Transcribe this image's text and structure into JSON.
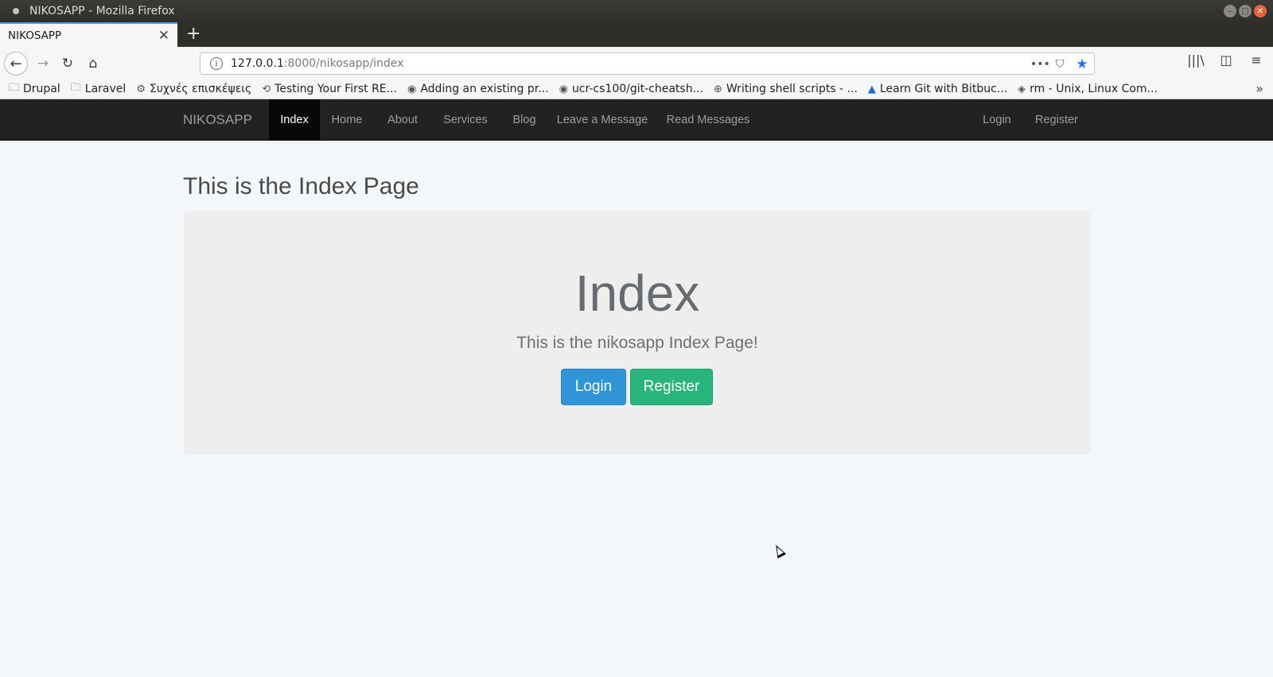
{
  "window": {
    "title": "NIKOSAPP - Mozilla Firefox"
  },
  "tab": {
    "label": "NIKOSAPP",
    "close_icon": "✕",
    "new_tab_icon": "+"
  },
  "urlbar": {
    "host": "127.0.0.1",
    "rest": ":8000/nikosapp/index",
    "more_icon": "•••",
    "pocket_icon": "⛉",
    "star_icon": "★"
  },
  "toolbar_icons": {
    "back": "←",
    "forward": "→",
    "reload": "↻",
    "home": "⌂",
    "library": "|||\\",
    "sidebar": "◫",
    "menu": "≡"
  },
  "bookmarks": [
    {
      "label": "Drupal",
      "icon": "folder-icon",
      "glyph": "🗀"
    },
    {
      "label": "Laravel",
      "icon": "folder-icon",
      "glyph": "🗀"
    },
    {
      "label": "Συχνές επισκέψεις",
      "icon": "gear-icon",
      "glyph": "⚙"
    },
    {
      "label": "Testing Your First RE...",
      "icon": "link-icon",
      "glyph": "⟲"
    },
    {
      "label": "Adding an existing pr...",
      "icon": "github-icon",
      "glyph": "◉"
    },
    {
      "label": "ucr-cs100/git-cheatsh...",
      "icon": "github-icon",
      "glyph": "◉"
    },
    {
      "label": "Writing shell scripts - ...",
      "icon": "globe-icon",
      "glyph": "⊕"
    },
    {
      "label": "Learn Git with Bitbuc...",
      "icon": "atlassian-icon",
      "glyph": "▲"
    },
    {
      "label": "rm - Unix, Linux Com...",
      "icon": "diamond-icon",
      "glyph": "◈"
    }
  ],
  "bookmarks_overflow_icon": "»",
  "site_nav": {
    "brand": "NIKOSAPP",
    "items": [
      "Index",
      "Home",
      "About",
      "Services",
      "Blog",
      "Leave a Message",
      "Read Messages"
    ],
    "right_items": [
      "Login",
      "Register"
    ],
    "active": "Index"
  },
  "page": {
    "heading": "This is the Index Page",
    "jumbotron_title": "Index",
    "jumbotron_lead": "This is the nikosapp Index Page!",
    "login_button": "Login",
    "register_button": "Register"
  },
  "colors": {
    "navbar_bg": "#222222",
    "login_btn": "#2f95d7",
    "register_btn": "#29b47c",
    "page_bg": "#f4f7f9",
    "jumbotron_bg": "#eeeeee"
  }
}
